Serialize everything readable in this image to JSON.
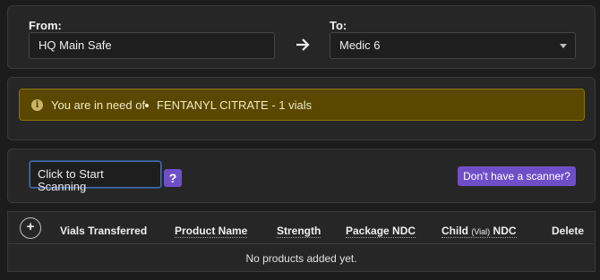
{
  "route": {
    "from_label": "From:",
    "from_value": "HQ Main Safe",
    "to_label": "To:",
    "to_value": "Medic 6",
    "arrow_icon": "arrow-right-icon"
  },
  "alert": {
    "icon": "info-circle-icon",
    "message": "You are in need of",
    "items": [
      "FENTANYL CITRATE - 1 vials"
    ],
    "colors": {
      "background": "#5a4800",
      "border": "#8c7400"
    }
  },
  "scanner": {
    "input_value": "Click to Start Scanning",
    "help_label": "?",
    "no_scanner_label": "Don't have a scanner?",
    "accent": "#6f4fc7"
  },
  "table": {
    "add_label": "+",
    "columns": {
      "vials": "Vials Transferred",
      "product": "Product Name",
      "strength": "Strength",
      "package_ndc": "Package NDC",
      "child_prefix": "Child",
      "child_small": "(Vial)",
      "child_suffix": "NDC",
      "delete": "Delete"
    },
    "empty_message": "No products added yet."
  }
}
